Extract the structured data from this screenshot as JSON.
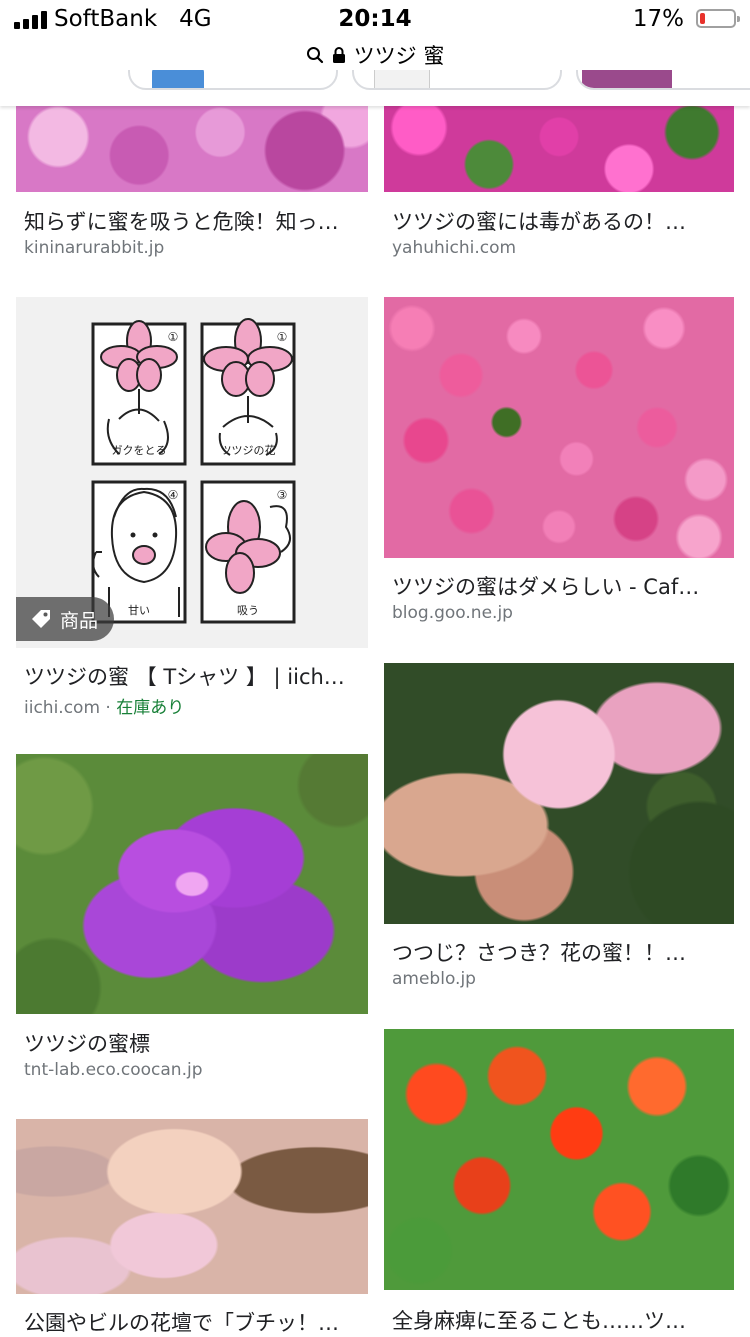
{
  "status_bar": {
    "carrier": "SoftBank",
    "network": "4G",
    "time": "20:14",
    "battery": "17%",
    "battery_level": 0.17
  },
  "url_bar": {
    "query": "ツツジ 蜜"
  },
  "results": [
    {
      "title": "知らずに蜜を吸うと危険！知っ…",
      "source": "kininarurabbit.jp"
    },
    {
      "title": "ツツジの蜜には毒があるの！…",
      "source": "yahuhichi.com"
    },
    {
      "title": "ツツジの蜜 【 Tシャツ 】 | iich…",
      "source": "iichi.com",
      "separator": " · ",
      "stock": "在庫あり",
      "badge": "商品",
      "panels": [
        {
          "num": "①",
          "caption": "ガクをとる"
        },
        {
          "num": "①",
          "caption": "ツツジの花"
        },
        {
          "num": "④",
          "caption": "甘い"
        },
        {
          "num": "③",
          "caption": "吸う"
        }
      ]
    },
    {
      "title": "ツツジの蜜はダメらしい - Caf…",
      "source": "blog.goo.ne.jp"
    },
    {
      "title": "ツツジの蜜標",
      "source": "tnt-lab.eco.coocan.jp"
    },
    {
      "title": "つつじ？さつき？花の蜜！！…",
      "source": "ameblo.jp"
    },
    {
      "title": "公園やビルの花壇で「ブチッ！…",
      "source": ""
    },
    {
      "title": "全身麻痺に至ることも……ツ…",
      "source": ""
    }
  ]
}
